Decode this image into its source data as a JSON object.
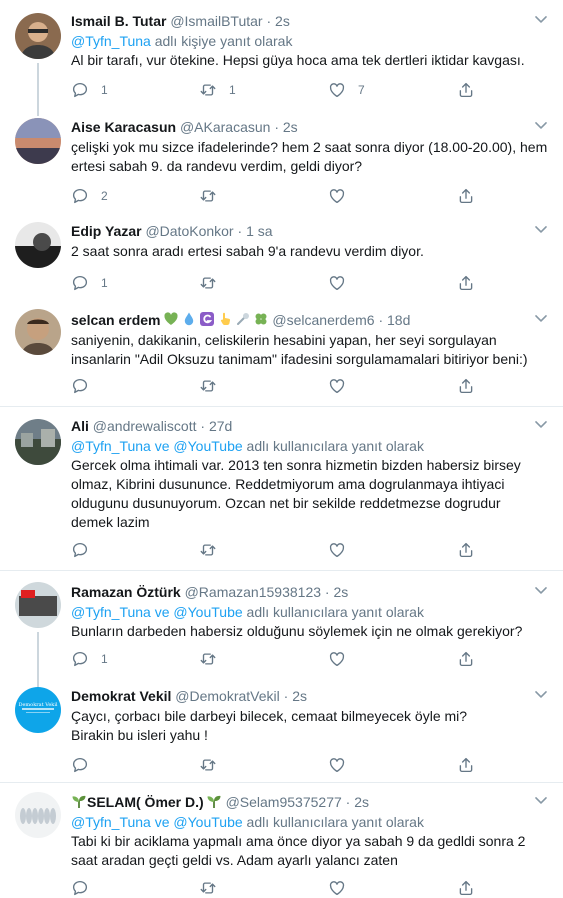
{
  "tweets": [
    {
      "name": "Ismail B. Tutar",
      "handle": "@IsmailBTutar",
      "dot": "·",
      "time": "2s",
      "reply_to": {
        "link": "@Tyfn_Tuna",
        "suffix": " adlı kişiye yanıt olarak"
      },
      "lines": [
        "Al bir tarafı, vur ötekine. Hepsi güya hoca ama tek dertleri iktidar kavgası."
      ],
      "counts": {
        "reply": "1",
        "retweet": "1",
        "like": "7"
      }
    },
    {
      "name": "Aise Karacasun",
      "handle": "@AKaracasun",
      "dot": "·",
      "time": "2s",
      "lines": [
        "çelişki yok mu sizce ifadelerinde? hem 2 saat sonra diyor (18.00-20.00), hem",
        "ertesi sabah 9. da randevu verdim, geldi diyor?"
      ],
      "counts": {
        "reply": "2",
        "retweet": "",
        "like": ""
      }
    },
    {
      "name": "Edip Yazar",
      "handle": "@DatoKonkor",
      "dot": "·",
      "time": "1 sa",
      "lines": [
        "2 saat sonra aradı ertesi sabah 9'a randevu verdim diyor."
      ],
      "counts": {
        "reply": "1",
        "retweet": "",
        "like": ""
      }
    },
    {
      "name": "selcan erdem",
      "handle": "@selcanerdem6",
      "dot": "·",
      "time": "18d",
      "emoji_icons": [
        "green-heart-icon",
        "droplet-icon",
        "g-letter-badge-icon",
        "pointing-hand-icon",
        "microphone-icon",
        "four-leaf-clover-icon"
      ],
      "lines": [
        "saniyenin, dakikanin, celiskilerin hesabini yapan, her seyi sorgulayan",
        "insanlarin \"Adil Oksuzu tanimam\" ifadesini sorgulamamalari bitiriyor beni:)"
      ],
      "counts": {
        "reply": "",
        "retweet": "",
        "like": ""
      }
    },
    {
      "name": "Ali",
      "handle": "@andrewaliscott",
      "dot": "·",
      "time": "27d",
      "reply_to": {
        "link": "@Tyfn_Tuna ve @YouTube",
        "suffix": " adlı kullanıcılara yanıt olarak"
      },
      "lines": [
        "Gercek olma ihtimali var. 2013 ten sonra hizmetin bizden habersiz birsey",
        "olmaz, Kibrini dusununce. Reddetmiyorum ama dogrulanmaya ihtiyaci",
        "oldugunu dusunuyorum. Ozcan net bir sekilde reddetmezse dogrudur",
        "demek lazim"
      ],
      "counts": {
        "reply": "",
        "retweet": "",
        "like": ""
      }
    },
    {
      "name": "Ramazan Öztürk",
      "handle": "@Ramazan15938123",
      "dot": "·",
      "time": "2s",
      "reply_to": {
        "link": "@Tyfn_Tuna ve @YouTube",
        "suffix": " adlı kullanıcılara yanıt olarak"
      },
      "lines": [
        "Bunların darbeden habersiz olduğunu söylemek için ne olmak gerekiyor?"
      ],
      "counts": {
        "reply": "1",
        "retweet": "",
        "like": ""
      }
    },
    {
      "name": "Demokrat Vekil",
      "handle": "@DemokratVekil",
      "dot": "·",
      "time": "2s",
      "avatar_text": "Demokrat Vekil",
      "lines": [
        "Çaycı, çorbacı bile darbeyi bilecek, cemaat bilmeyecek öyle mi?",
        "Birakin bu isleri yahu !"
      ],
      "counts": {
        "reply": "",
        "retweet": "",
        "like": ""
      }
    },
    {
      "name_prefix_icon": "seedling-icon",
      "name": "SELAM( Ömer D.)",
      "name_suffix_icon": "seedling-icon",
      "handle": "@Selam95375277",
      "dot": "·",
      "time": "2s",
      "reply_to": {
        "link": "@Tyfn_Tuna ve @YouTube",
        "suffix": " adlı kullanıcılara yanıt olarak"
      },
      "lines": [
        "Tabi ki bir aciklama yapmalı ama önce diyor ya sabah 9 da gedldi sonra 2",
        "saat aradan geçti geldi vs. Adam ayarlı yalancı zaten"
      ],
      "counts": {
        "reply": "",
        "retweet": "",
        "like": ""
      }
    }
  ],
  "colors": {
    "link": "#1da1f2",
    "muted": "#657786",
    "text": "#14171a",
    "border": "#e6ecf0",
    "thread": "#ccd6dd",
    "like_heart_green": "#77b255"
  }
}
